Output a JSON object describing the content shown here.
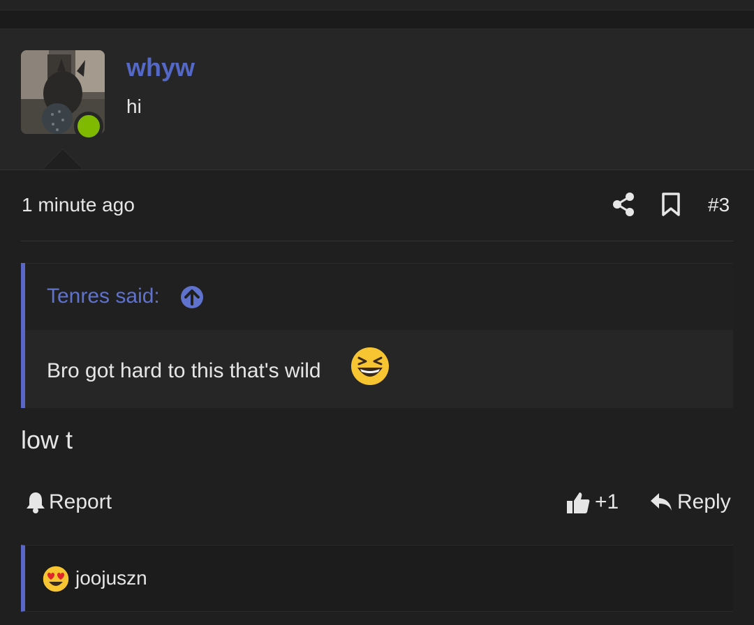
{
  "post": {
    "username": "whyw",
    "user_title": "hi",
    "timestamp": "1 minute ago",
    "post_number": "#3",
    "online": true
  },
  "quote": {
    "author": "Tenres said:",
    "text": "Bro got hard to this that's wild",
    "emoji": "laughing-emoji"
  },
  "message": "low t",
  "actions": {
    "report_label": "Report",
    "like_label": "+1",
    "reply_label": "Reply"
  },
  "reactions": {
    "emoji": "heart-eyes-emoji",
    "user": "joojuszn"
  },
  "colors": {
    "accent": "#5a67c7",
    "username": "#5468c8",
    "online": "#7fba00",
    "background": "#1f1f20"
  }
}
